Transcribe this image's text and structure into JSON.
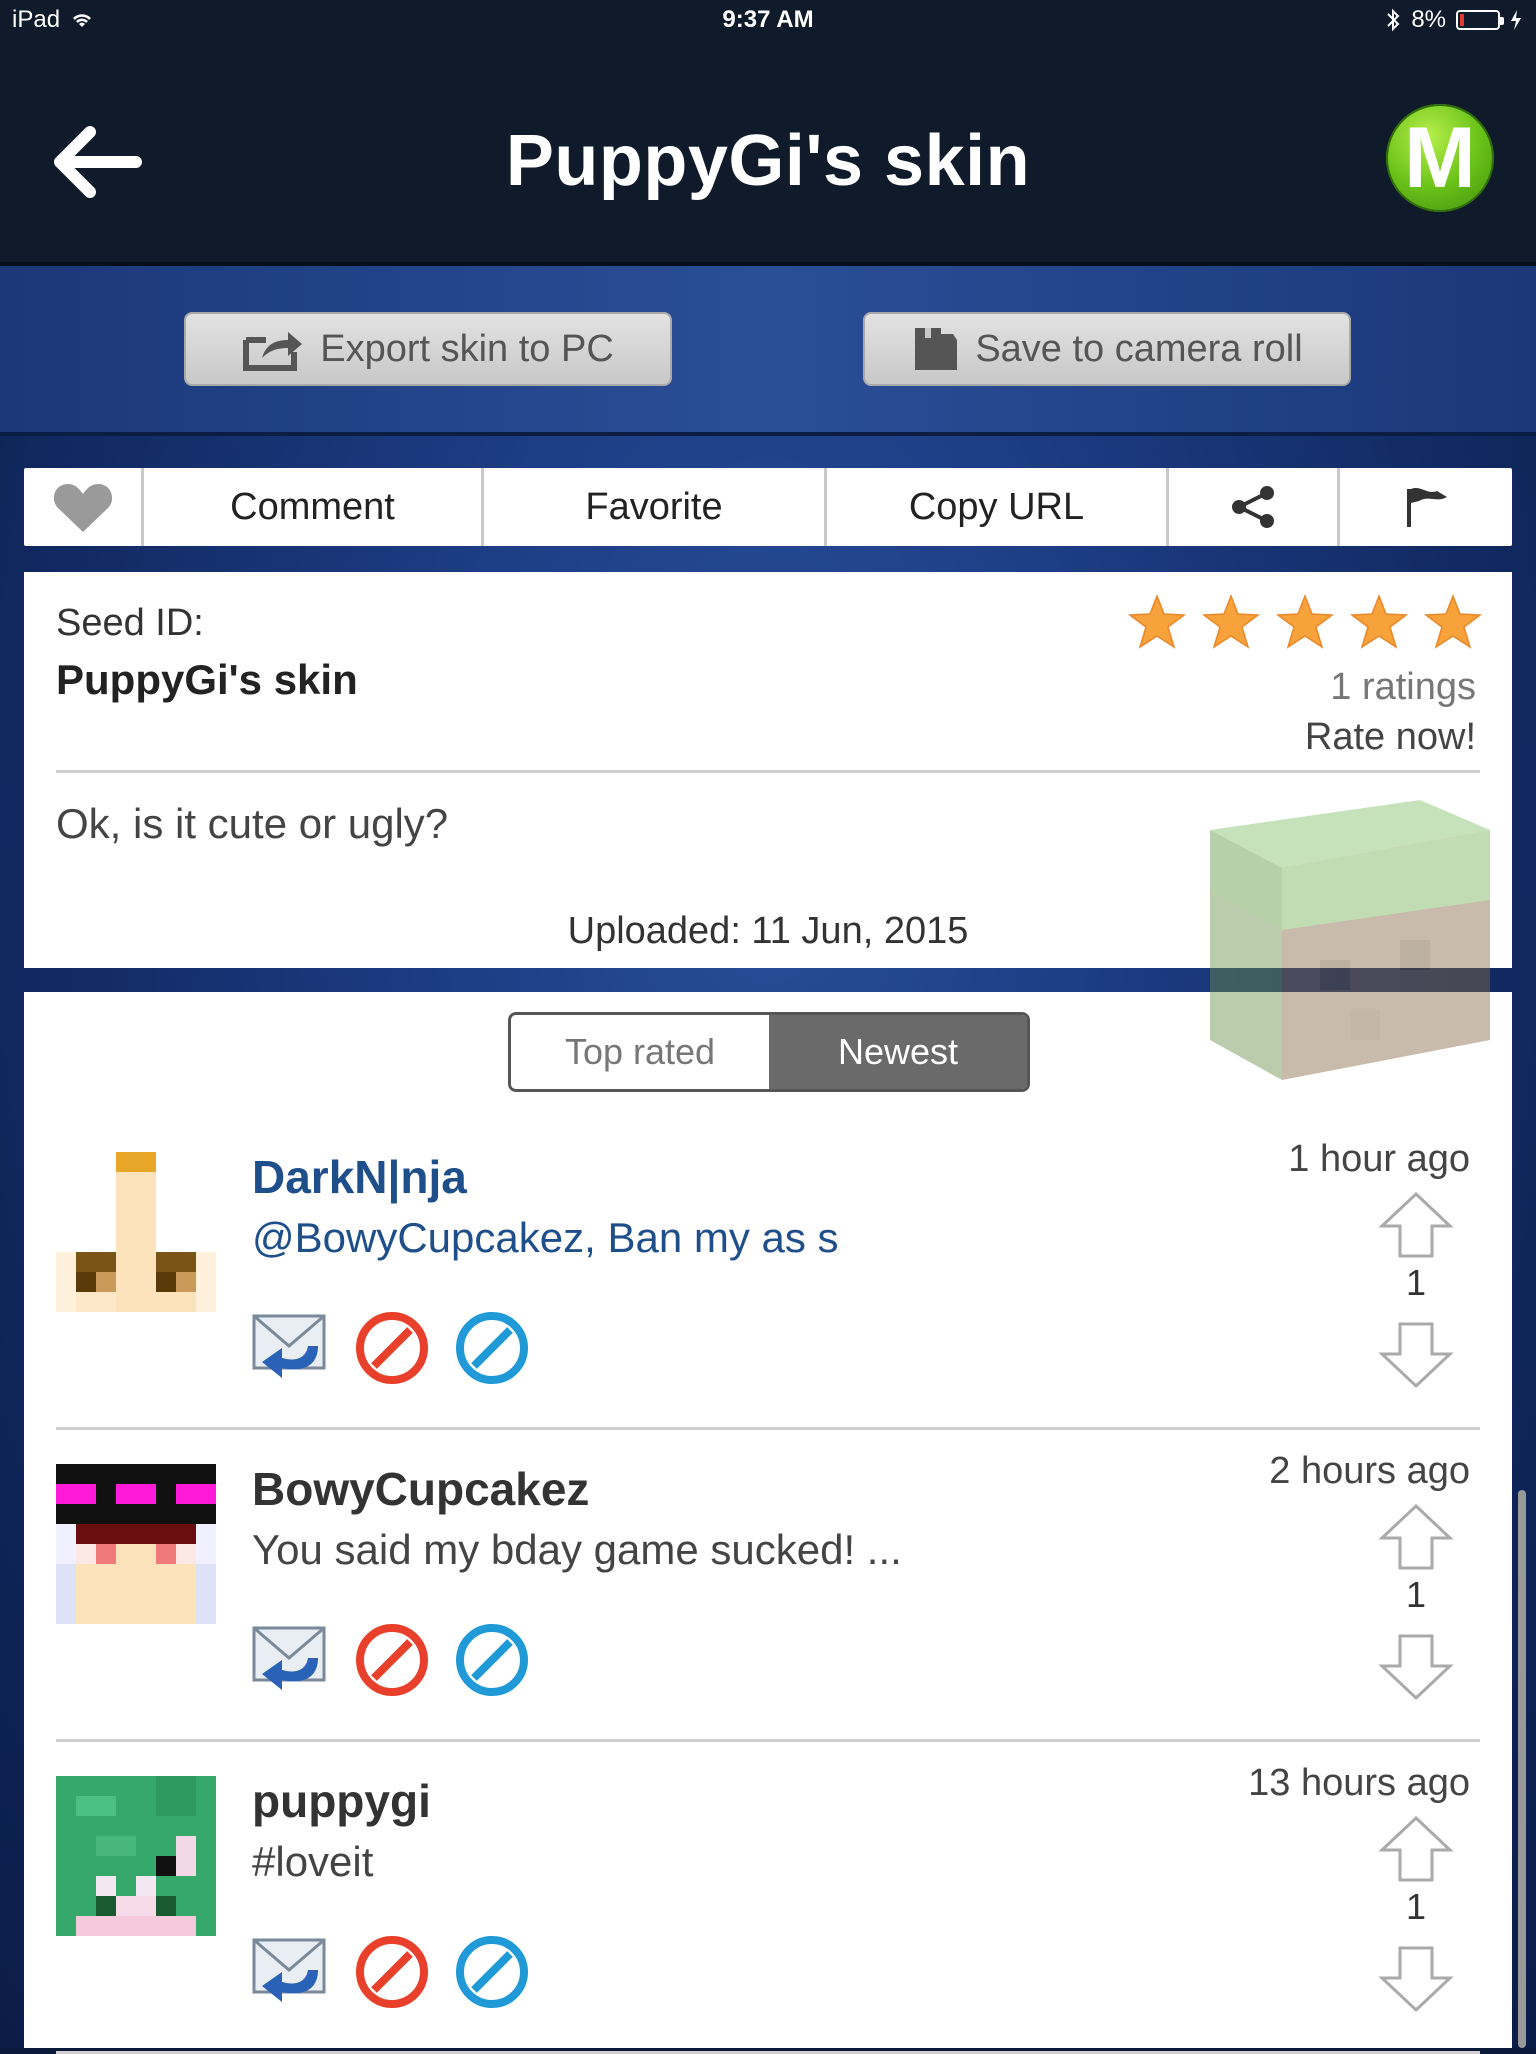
{
  "status_bar": {
    "device": "iPad",
    "time": "9:37 AM",
    "battery": "8%"
  },
  "nav": {
    "title": "PuppyGi's skin",
    "logo_letter": "M"
  },
  "export": {
    "export_label": "Export skin to PC",
    "save_label": "Save to camera roll"
  },
  "tabs": {
    "comment": "Comment",
    "favorite": "Favorite",
    "copy_url": "Copy URL"
  },
  "info": {
    "seed_label": "Seed ID:",
    "seed_name": "PuppyGi's skin",
    "rating_stars": 5,
    "ratings": "1 ratings",
    "rate_now": "Rate now!",
    "description": "Ok, is it cute or ugly?",
    "uploaded": "Uploaded: 11 Jun, 2015"
  },
  "sort": {
    "top_rated": "Top rated",
    "newest": "Newest",
    "selected": "Newest"
  },
  "comments": [
    {
      "user": "DarkN|nja",
      "text": "@BowyCupcakez, Ban my as s",
      "time": "1 hour ago",
      "votes": "1"
    },
    {
      "user": "BowyCupcakez",
      "text": "You said my bday game sucked! ...",
      "time": "2 hours ago",
      "votes": "1"
    },
    {
      "user": "puppygi",
      "text": "#loveit",
      "time": "13 hours ago",
      "votes": "1"
    }
  ],
  "colors": {
    "accent_blue": "#1f4f8a",
    "logo_green": "#6cc31a",
    "star_orange": "#f7a23a"
  }
}
